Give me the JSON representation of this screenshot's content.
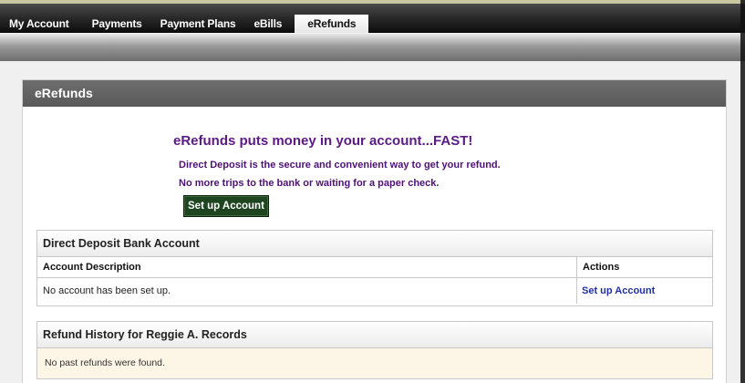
{
  "nav": {
    "tabs": [
      {
        "label": "My Account"
      },
      {
        "label": "Payments"
      },
      {
        "label": "Payment Plans"
      },
      {
        "label": "eBills"
      },
      {
        "label": "eRefunds",
        "active": true
      }
    ]
  },
  "panel": {
    "title": "eRefunds"
  },
  "promo": {
    "headline": "eRefunds puts money in your account...FAST!",
    "line1": "Direct Deposit is the secure and convenient way to get your refund.",
    "line2": "No more trips to the bank or waiting for a paper check.",
    "button_label": "Set up Account"
  },
  "bank_account": {
    "title": "Direct Deposit Bank Account",
    "columns": [
      "Account Description",
      "Actions"
    ],
    "rows": [
      {
        "description": "No account has been set up.",
        "action": "Set up Account"
      }
    ]
  },
  "refund_history": {
    "title": "Refund History for Reggie A. Records",
    "empty_message": "No past refunds were found."
  },
  "colors": {
    "promo_purple": "#5c1a84",
    "button_green": "#1e4420",
    "link_blue": "#1f2fa8",
    "header_gray": "#606060",
    "history_bg": "#fdf6e6"
  }
}
